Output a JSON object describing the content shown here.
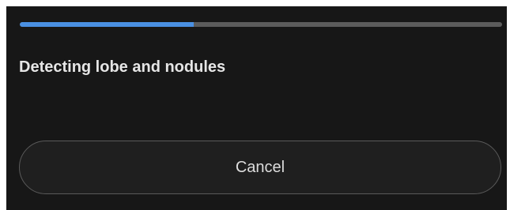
{
  "progress": {
    "fraction": 0.36,
    "fill_color": "#4a90e2",
    "track_color": "#5c5c5c"
  },
  "status": {
    "text": "Detecting lobe and nodules"
  },
  "actions": {
    "cancel_label": "Cancel"
  }
}
